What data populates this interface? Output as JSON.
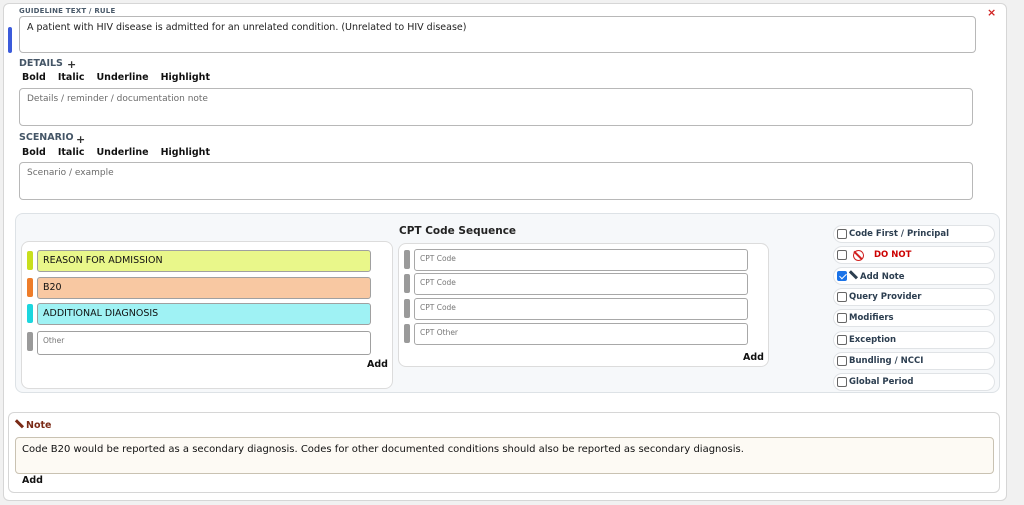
{
  "guideline": {
    "label": "GUIDELINE TEXT / RULE",
    "text": "A patient with HIV disease is admitted for an unrelated condition. (Unrelated to HIV disease)"
  },
  "close_symbol": "×",
  "details": {
    "label": "DETAILS",
    "plus": "+",
    "format": [
      "Bold",
      "Italic",
      "Underline",
      "Highlight"
    ],
    "placeholder": "Details / reminder / documentation note"
  },
  "scenario": {
    "label": "SCENARIO",
    "plus": "+",
    "format": [
      "Bold",
      "Italic",
      "Underline",
      "Highlight"
    ],
    "placeholder": "Scenario / example"
  },
  "diagnosis": {
    "rows": [
      {
        "text": "REASON FOR ADMISSION",
        "color": "#e9f78a",
        "handle": "#c8df1e"
      },
      {
        "text": "B20",
        "color": "#f8c8a2",
        "handle": "#ee7d2a"
      },
      {
        "text": "ADDITIONAL DIAGNOSIS",
        "color": "#9ff2f4",
        "handle": "#1cd6de"
      }
    ],
    "other_placeholder": "Other",
    "add_label": "Add"
  },
  "cpt": {
    "title": "CPT Code Sequence",
    "placeholders": [
      "CPT Code",
      "CPT Code",
      "CPT Code",
      "CPT Other"
    ],
    "add_label": "Add"
  },
  "options": [
    {
      "label": "Code First / Principal",
      "checked": false
    },
    {
      "label": "DO NOT",
      "checked": false
    },
    {
      "label": "Add Note",
      "checked": true
    },
    {
      "label": "Query Provider",
      "checked": false
    },
    {
      "label": "Modifiers",
      "checked": false
    },
    {
      "label": "Exception",
      "checked": false
    },
    {
      "label": "Bundling / NCCI",
      "checked": false
    },
    {
      "label": "Global Period",
      "checked": false
    }
  ],
  "note": {
    "title": "Note",
    "text": "Code B20 would be reported as a secondary diagnosis. Codes for other documented conditions should also be reported as secondary diagnosis.",
    "add_label": "Add"
  }
}
